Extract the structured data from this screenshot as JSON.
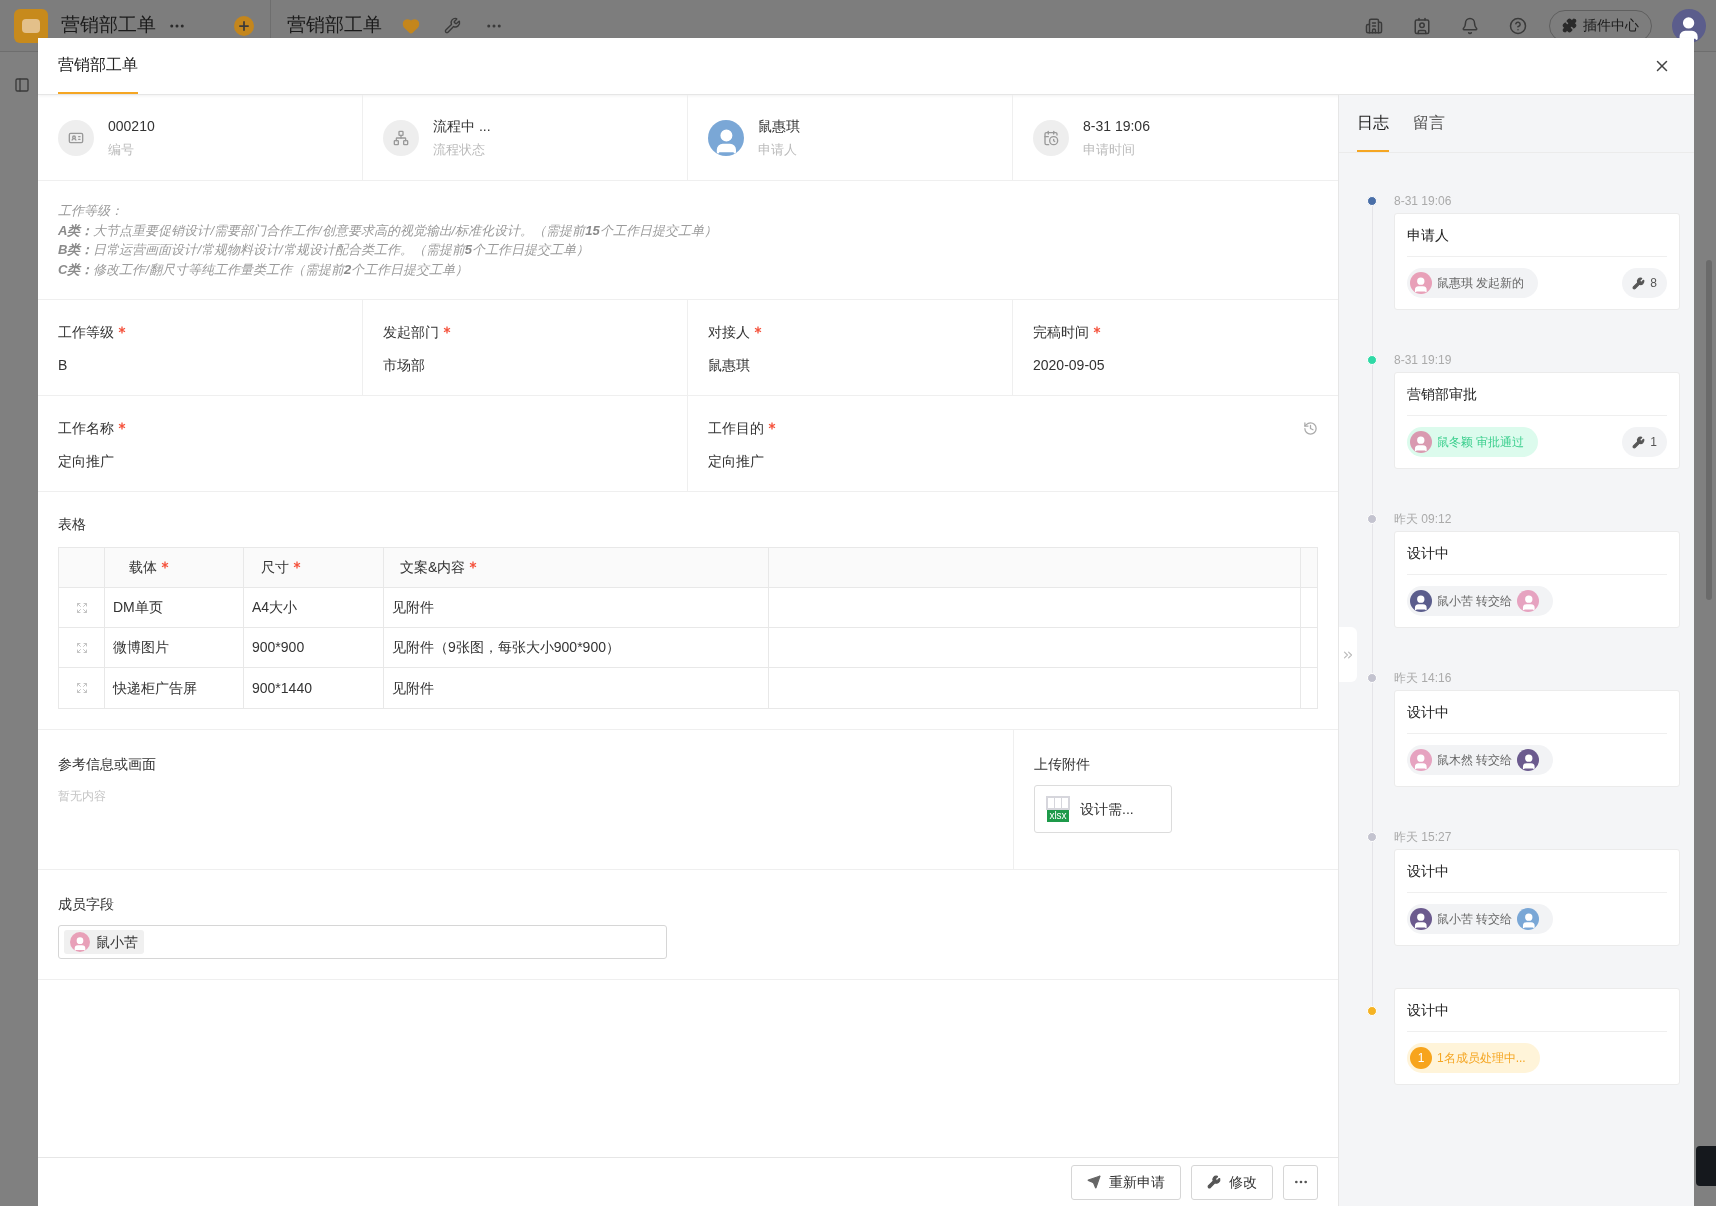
{
  "app_bar": {
    "title": "营销部工单",
    "page_title": "营销部工单",
    "plugin_button": "插件中心"
  },
  "dialog": {
    "title": "营销部工单"
  },
  "summary": [
    {
      "kind": "id",
      "value": "000210",
      "label": "编号"
    },
    {
      "kind": "flow",
      "value": "流程中 ...",
      "label": "流程状态"
    },
    {
      "kind": "person",
      "value": "鼠惠琪",
      "label": "申请人"
    },
    {
      "kind": "time",
      "value": "8-31 19:06",
      "label": "申请时间"
    }
  ],
  "instructions": [
    "工作等级：",
    "**A类：**大节点重要促销设计/需要部门合作工作/创意要求高的视觉输出/标准化设计。（需提前**15**个工作日提交工单）",
    "**B类：**日常运营画面设计/常规物料设计/常规设计配合类工作。（需提前**5**个工作日提交工单）",
    "**C类：**修改工作/翻尺寸等纯工作量类工作（需提前**2**个工作日提交工单）"
  ],
  "field_rows": [
    [
      {
        "label": "工作等级",
        "required": true,
        "value": "B"
      },
      {
        "label": "发起部门",
        "required": true,
        "value": "市场部"
      },
      {
        "label": "对接人",
        "required": true,
        "value": "鼠惠琪"
      },
      {
        "label": "完稿时间",
        "required": true,
        "value": "2020-09-05"
      }
    ],
    [
      {
        "label": "工作名称",
        "required": true,
        "value": "定向推广"
      },
      {
        "label": "工作目的",
        "required": true,
        "value": "定向推广",
        "history": true
      }
    ]
  ],
  "table": {
    "title": "表格",
    "columns": [
      {
        "label": "载体",
        "required": true
      },
      {
        "label": "尺寸",
        "required": true
      },
      {
        "label": "文案&内容",
        "required": true
      }
    ],
    "rows": [
      [
        "DM单页",
        "A4大小",
        "见附件"
      ],
      [
        "微博图片",
        "900*900",
        "见附件（9张图，每张大小900*900）"
      ],
      [
        "快递柜广告屏",
        "900*1440",
        "见附件"
      ]
    ]
  },
  "reference": {
    "label": "参考信息或画面",
    "empty_text": "暂无内容"
  },
  "attachment": {
    "label": "上传附件",
    "file": {
      "type": "xlsx",
      "name": "设计需..."
    }
  },
  "member_field": {
    "label": "成员字段",
    "members": [
      {
        "name": "鼠小苦"
      }
    ]
  },
  "footer": {
    "buttons": [
      {
        "kind": "resubmit",
        "label": "重新申请"
      },
      {
        "kind": "edit",
        "label": "修改"
      },
      {
        "kind": "more"
      }
    ]
  },
  "panel": {
    "tabs": [
      {
        "label": "日志",
        "selected": true
      },
      {
        "label": "留言",
        "selected": false
      }
    ],
    "log": [
      {
        "time": "8-31 19:06",
        "color": "#4a6fa8",
        "title": "申请人",
        "chip": {
          "kind": "plain",
          "name": "鼠惠琪",
          "action": "发起新的",
          "to_avatar": false
        },
        "count": "8"
      },
      {
        "time": "8-31 19:19",
        "color": "#2fd9a6",
        "title": "营销部审批",
        "chip": {
          "kind": "approved",
          "name": "鼠冬颖",
          "action": "审批通过",
          "to_avatar": false
        },
        "count": "1"
      },
      {
        "time": "昨天 09:12",
        "color": "#c3c3cf",
        "title": "设计中",
        "chip": {
          "kind": "plain",
          "name": "鼠小苦",
          "action": "转交给",
          "to_avatar": true
        }
      },
      {
        "time": "昨天 14:16",
        "color": "#c3c3cf",
        "title": "设计中",
        "chip": {
          "kind": "plain",
          "name": "鼠木然",
          "action": "转交给",
          "to_avatar": true
        }
      },
      {
        "time": "昨天 15:27",
        "color": "#c3c3cf",
        "title": "设计中",
        "chip": {
          "kind": "plain",
          "name": "鼠小苦",
          "action": "转交给",
          "to_avatar": true
        }
      },
      {
        "color": "#f5b324",
        "title": "设计中",
        "chip": {
          "kind": "pending",
          "badge": "1",
          "text": "1名成员处理中..."
        }
      }
    ]
  }
}
